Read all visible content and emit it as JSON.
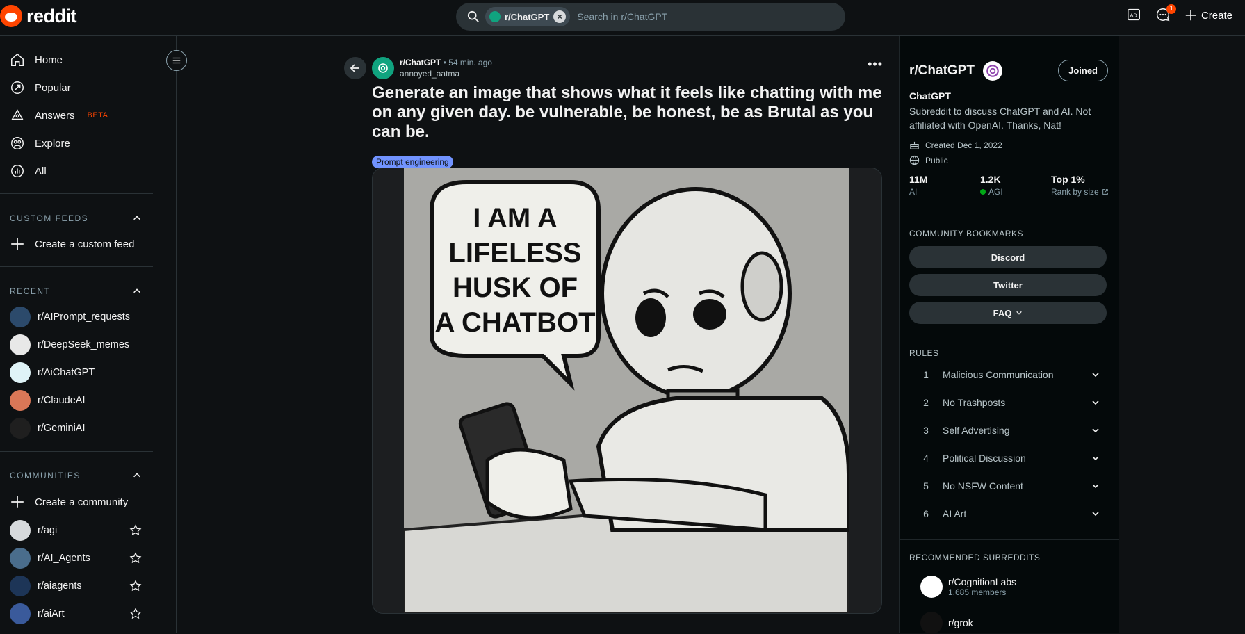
{
  "brand": {
    "name": "reddit",
    "accent": "#ff4500"
  },
  "search": {
    "chip": "r/ChatGPT",
    "placeholder": "Search in r/ChatGPT"
  },
  "header": {
    "notification_count": "1",
    "create_label": "Create"
  },
  "left_nav": {
    "items": [
      {
        "label": "Home"
      },
      {
        "label": "Popular"
      },
      {
        "label": "Answers",
        "badge": "BETA"
      },
      {
        "label": "Explore"
      },
      {
        "label": "All"
      }
    ],
    "custom_feeds": {
      "title": "CUSTOM FEEDS",
      "create": "Create a custom feed"
    },
    "recent": {
      "title": "RECENT",
      "items": [
        "r/AIPrompt_requests",
        "r/DeepSeek_memes",
        "r/AiChatGPT",
        "r/ClaudeAI",
        "r/GeminiAI"
      ]
    },
    "communities": {
      "title": "COMMUNITIES",
      "create": "Create a community",
      "items": [
        "r/agi",
        "r/AI_Agents",
        "r/aiagents",
        "r/aiArt"
      ]
    }
  },
  "post": {
    "subreddit": "r/ChatGPT",
    "time": "54 min. ago",
    "author": "annoyed_aatma",
    "title": "Generate an image that shows what it feels like chatting with me on any given day. be vulnerable, be honest, be as Brutal as you can be.",
    "flair": "Prompt engineering",
    "image_caption": "I AM A LIFELESS HUSK OF A CHATBOT"
  },
  "sidebar": {
    "name": "r/ChatGPT",
    "joined_label": "Joined",
    "title": "ChatGPT",
    "description": "Subreddit to discuss ChatGPT and AI. Not affiliated with OpenAI. Thanks, Nat!",
    "created": "Created Dec 1, 2022",
    "visibility": "Public",
    "stats": [
      {
        "value": "11M",
        "label": "AI"
      },
      {
        "value": "1.2K",
        "label": "AGI"
      },
      {
        "value": "Top 1%",
        "label": "Rank by size"
      }
    ],
    "bookmarks_title": "COMMUNITY BOOKMARKS",
    "bookmarks": [
      "Discord",
      "Twitter",
      "FAQ"
    ],
    "rules_title": "RULES",
    "rules": [
      {
        "n": "1",
        "text": "Malicious Communication"
      },
      {
        "n": "2",
        "text": "No Trashposts"
      },
      {
        "n": "3",
        "text": "Self Advertising"
      },
      {
        "n": "4",
        "text": "Political Discussion"
      },
      {
        "n": "5",
        "text": "No NSFW Content"
      },
      {
        "n": "6",
        "text": "AI Art"
      }
    ],
    "recommended_title": "RECOMMENDED SUBREDDITS",
    "recommended": [
      {
        "name": "r/CognitionLabs",
        "members": "1,685 members"
      },
      {
        "name": "r/grok",
        "members": ""
      }
    ]
  }
}
